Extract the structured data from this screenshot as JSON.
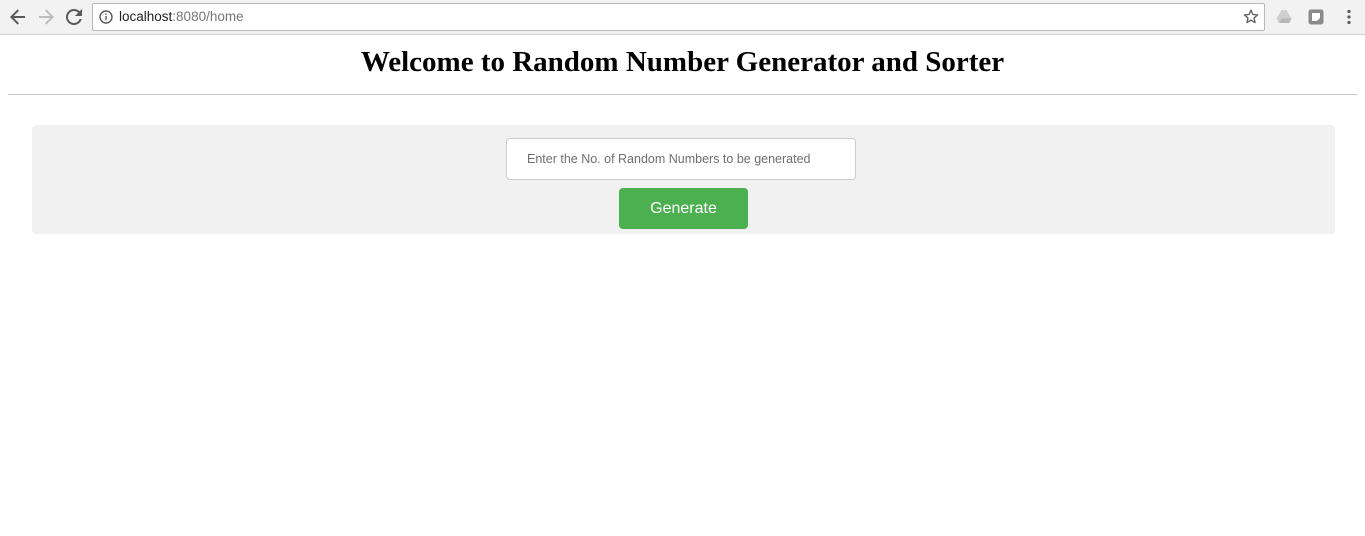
{
  "browser": {
    "url_host": "localhost",
    "url_rest": ":8080/home",
    "icons": {
      "back": "back-arrow-icon",
      "forward": "forward-arrow-icon",
      "reload": "reload-icon",
      "info": "info-icon",
      "bookmark": "star-icon",
      "extension1": "drive-icon",
      "extension2": "extension-icon",
      "menu": "menu-dots-icon"
    }
  },
  "page": {
    "title": "Welcome to Random Number Generator and Sorter"
  },
  "form": {
    "input_placeholder": "Enter the No. of Random Numbers to be generated",
    "input_value": "",
    "generate_label": "Generate"
  },
  "colors": {
    "button": "#4caf50",
    "panel": "#f1f1f1"
  }
}
